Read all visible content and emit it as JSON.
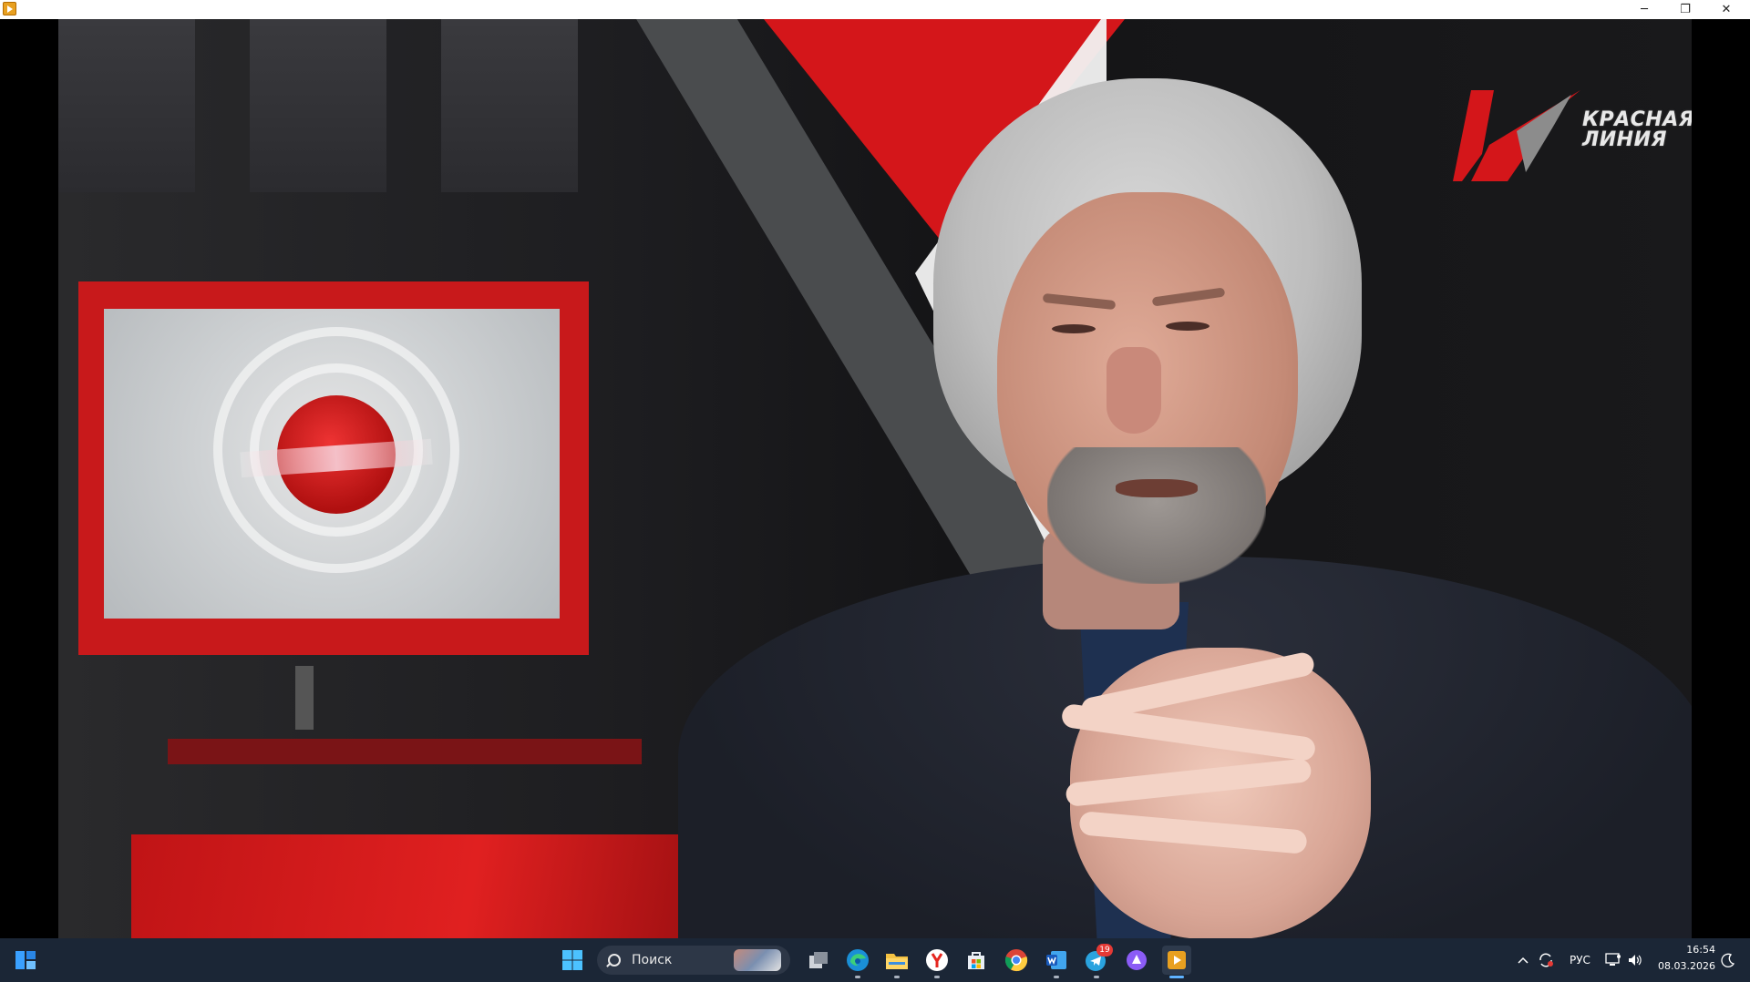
{
  "window": {
    "title": "",
    "controls": {
      "minimize": "─",
      "restore": "❐",
      "close": "✕"
    }
  },
  "video": {
    "channel_logo": {
      "line1": "КРАСНАЯ",
      "line2": "ЛИНИЯ"
    },
    "colors": {
      "accent_red": "#d4161a",
      "studio_dark": "#1a1a1c"
    }
  },
  "taskbar": {
    "search_placeholder": "Поиск",
    "apps": [
      "widgets",
      "start",
      "search",
      "task-view",
      "edge",
      "file-explorer",
      "yandex-browser",
      "microsoft-store",
      "chrome",
      "word",
      "telegram",
      "proton",
      "media-player"
    ],
    "telegram_badge": "19",
    "tray": {
      "language": "РУС",
      "time": "16:54",
      "date": "08.03.2026"
    }
  }
}
